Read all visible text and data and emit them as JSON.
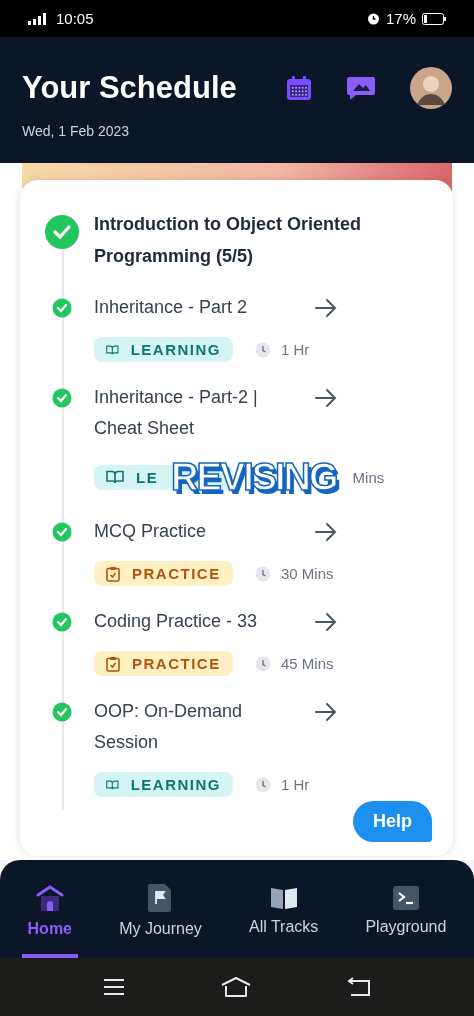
{
  "status_bar": {
    "time": "10:05",
    "battery": "17%"
  },
  "header": {
    "title": "Your Schedule",
    "date": "Wed, 1 Feb 2023"
  },
  "module": {
    "title": "Introduction to Object Oriented Programming (5/5)",
    "done": true
  },
  "items": [
    {
      "title": "Inheritance - Part 2",
      "done": true,
      "kind": "learning",
      "badge": "LEARNING",
      "duration": "1 Hr"
    },
    {
      "title": "Inheritance - Part-2 | Cheat Sheet",
      "done": true,
      "kind": "learning",
      "badge": "LE",
      "duration": "Mins",
      "sticker": "REVISING"
    },
    {
      "title": "MCQ Practice",
      "done": true,
      "kind": "practice",
      "badge": "PRACTICE",
      "duration": "30 Mins"
    },
    {
      "title": "Coding Practice - 33",
      "done": true,
      "kind": "practice",
      "badge": "PRACTICE",
      "duration": "45 Mins"
    },
    {
      "title": "OOP: On-Demand Session",
      "done": true,
      "kind": "learning",
      "badge": "LEARNING",
      "duration": "1 Hr"
    }
  ],
  "help": "Help",
  "nav": [
    {
      "label": "Home",
      "kind": "home",
      "selected": true
    },
    {
      "label": "My Journey",
      "kind": "journey",
      "selected": false
    },
    {
      "label": "All Tracks",
      "kind": "tracks",
      "selected": false
    },
    {
      "label": "Playground",
      "kind": "playground",
      "selected": false
    }
  ]
}
